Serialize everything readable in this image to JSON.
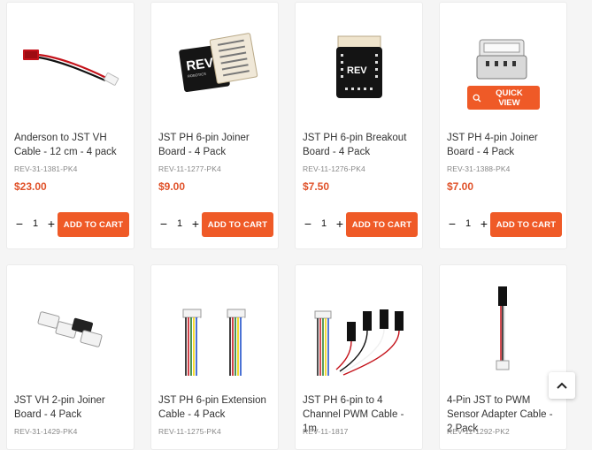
{
  "products": [
    {
      "name": "Anderson to JST VH Cable - 12 cm - 4 pack",
      "sku": "REV-31-1381-PK4",
      "price": "$23.00",
      "qty": "1",
      "add_label": "ADD TO CART",
      "image_icon": "cable-red-black"
    },
    {
      "name": "JST PH 6-pin Joiner Board - 4 Pack",
      "sku": "REV-11-1277-PK4",
      "price": "$9.00",
      "qty": "1",
      "add_label": "ADD TO CART",
      "image_icon": "rev-joiner-board"
    },
    {
      "name": "JST PH 6-pin Breakout Board - 4 Pack",
      "sku": "REV-11-1276-PK4",
      "price": "$7.50",
      "qty": "1",
      "add_label": "ADD TO CART",
      "image_icon": "rev-breakout-board"
    },
    {
      "name": "JST PH 4-pin Joiner Board - 4 Pack",
      "sku": "REV-31-1388-PK4",
      "price": "$7.00",
      "qty": "1",
      "add_label": "ADD TO CART",
      "image_icon": "connector-stack",
      "quick_view_label": "QUICK VIEW"
    },
    {
      "name": "JST VH 2-pin Joiner Board - 4 Pack",
      "sku": "REV-31-1429-PK4",
      "image_icon": "small-joiner-boards"
    },
    {
      "name": "JST PH 6-pin Extension Cable - 4 Pack",
      "sku": "REV-11-1275-PK4",
      "image_icon": "ribbon-cables"
    },
    {
      "name": "JST PH 6-pin to 4 Channel PWM Cable - 1m",
      "sku": "REV-11-1817",
      "image_icon": "pwm-cable"
    },
    {
      "name": "4-Pin JST to PWM Sensor Adapter Cable - 2 Pack",
      "sku": "REV-11-1292-PK2",
      "image_icon": "sensor-adapter-cable"
    }
  ],
  "colors": {
    "accent": "#ef5a27",
    "price": "#e0522a"
  },
  "back_to_top_icon": "chevron-up-icon"
}
